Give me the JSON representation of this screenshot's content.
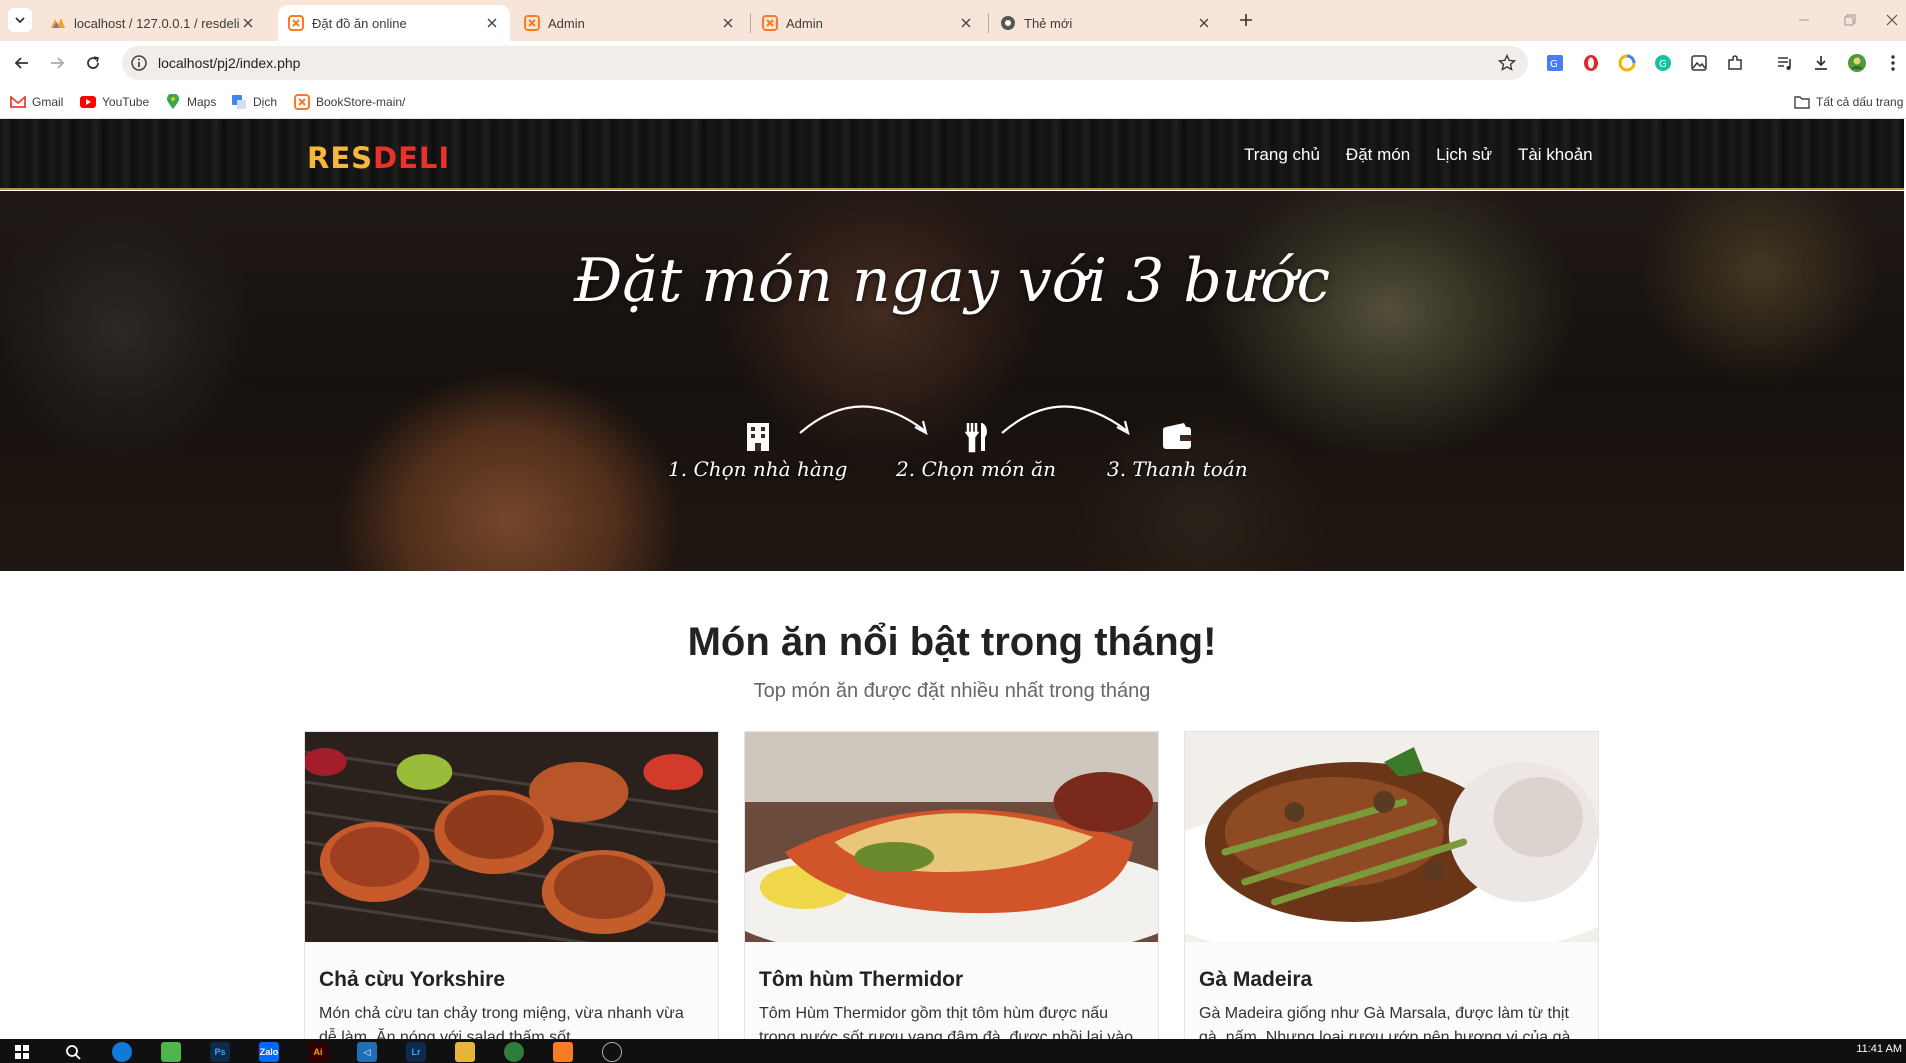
{
  "browser": {
    "tabs": [
      {
        "label": "localhost / 127.0.0.1 / resdeli / ...",
        "favicon": "phpmyadmin-icon",
        "active": false
      },
      {
        "label": "Đặt đồ ăn online",
        "favicon": "xampp-icon",
        "active": true
      },
      {
        "label": "Admin",
        "favicon": "xampp-icon",
        "active": false
      },
      {
        "label": "Admin",
        "favicon": "xampp-icon",
        "active": false
      },
      {
        "label": "Thẻ mới",
        "favicon": "chrome-icon",
        "active": false
      }
    ],
    "url": "localhost/pj2/index.php",
    "bookmarks": [
      {
        "label": "Gmail",
        "icon": "gmail-icon"
      },
      {
        "label": "YouTube",
        "icon": "youtube-icon"
      },
      {
        "label": "Maps",
        "icon": "maps-icon"
      },
      {
        "label": "Dịch",
        "icon": "translate-icon"
      },
      {
        "label": "BookStore-main/",
        "icon": "xampp-icon"
      }
    ],
    "all_bookmarks_label": "Tất cả dấu trang"
  },
  "site": {
    "logo_res": "RES",
    "logo_deli": "DELI",
    "nav": [
      "Trang chủ",
      "Đặt món",
      "Lịch sử",
      "Tài khoản"
    ]
  },
  "hero": {
    "title": "Đặt món ngay với 3 bước",
    "steps": [
      {
        "label": "1. Chọn nhà hàng",
        "icon": "building-icon"
      },
      {
        "label": "2. Chọn món ăn",
        "icon": "utensils-icon"
      },
      {
        "label": "3. Thanh toán",
        "icon": "wallet-icon"
      }
    ]
  },
  "featured": {
    "title": "Món ăn nổi bật trong tháng!",
    "subtitle": "Top món ăn được đặt nhiều nhất trong tháng",
    "items": [
      {
        "name": "Chả cừu Yorkshire",
        "desc": "Món chả cừu tan chảy trong miệng, vừa nhanh vừa dễ làm. Ăn nóng với salad thấm sốt"
      },
      {
        "name": "Tôm hùm Thermidor",
        "desc": "Tôm Hùm Thermidor gồm thịt tôm hùm được nấu trong nước sốt rượu vang đậm đà, được nhồi lại vào"
      },
      {
        "name": "Gà Madeira",
        "desc": "Gà Madeira giống như Gà Marsala, được làm từ thịt gà, nấm. Nhưng loại rượu ướp nên hương vị của gà"
      }
    ]
  },
  "taskbar": {
    "clock": "11:41 AM"
  },
  "colors": {
    "logo_res": "#f6b73a",
    "logo_deli": "#e8322a",
    "header_border": "#b8963a",
    "tabbar_bg": "#f8e5d9"
  }
}
